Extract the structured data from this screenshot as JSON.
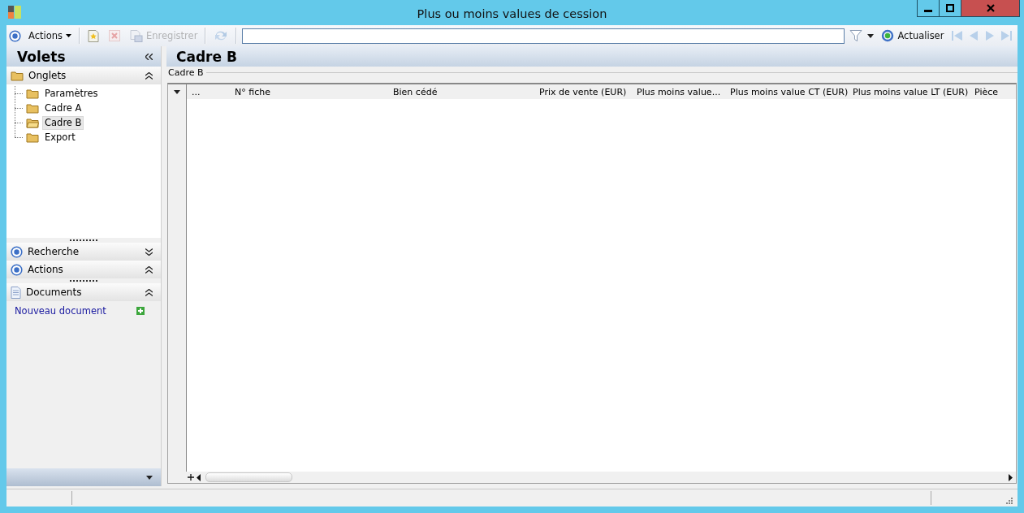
{
  "window": {
    "title": "Plus ou moins values de cession"
  },
  "toolbar": {
    "actions_label": "Actions",
    "buttons": [
      {
        "kind": "new",
        "disabled": false
      },
      {
        "kind": "delete",
        "disabled": true
      },
      {
        "kind": "save",
        "label": "Enregistrer",
        "disabled": true
      },
      {
        "kind": "refresh",
        "disabled": true
      }
    ],
    "refresh_label": "Actualiser"
  },
  "sidebar": {
    "title": "Volets",
    "sections": [
      {
        "kind": "folder",
        "title": "Onglets",
        "expanded": true,
        "items": [
          {
            "label": "Paramètres",
            "selected": false
          },
          {
            "label": "Cadre A",
            "selected": false
          },
          {
            "label": "Cadre B",
            "selected": true
          },
          {
            "label": "Export",
            "selected": false
          }
        ]
      },
      {
        "kind": "circle",
        "title": "Recherche",
        "expanded": false
      },
      {
        "kind": "circle",
        "title": "Actions",
        "expanded": true
      },
      {
        "kind": "document",
        "title": "Documents",
        "expanded": true,
        "links": [
          "Nouveau document"
        ]
      }
    ]
  },
  "main": {
    "title": "Cadre B",
    "group_label": "Cadre B",
    "table": {
      "columns": [
        "...",
        "N° fiche",
        "Bien cédé",
        "Prix de vente (EUR)",
        "Plus moins value...",
        "Plus moins value CT (EUR)",
        "Plus moins value LT (EUR)",
        "Pièce"
      ]
    }
  }
}
